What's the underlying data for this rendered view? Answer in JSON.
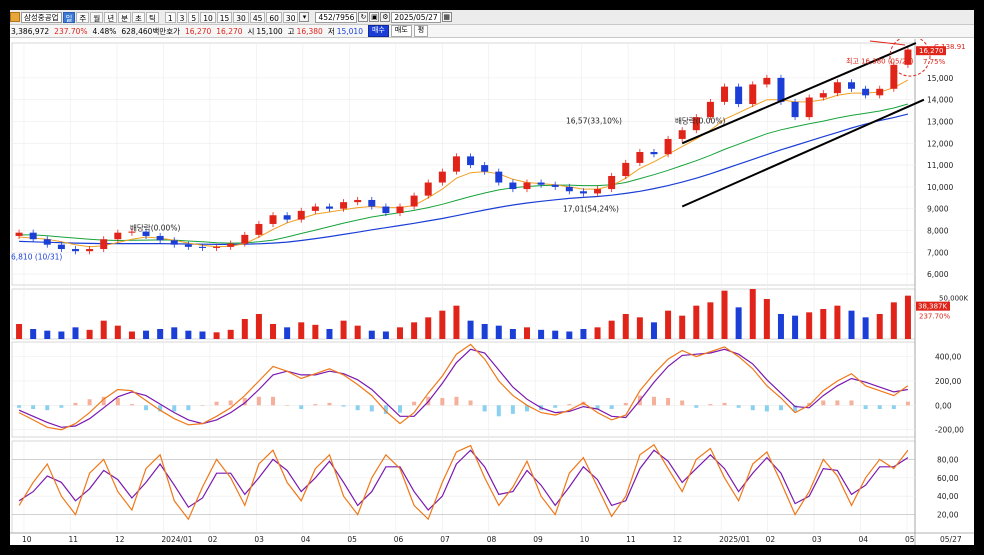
{
  "toolbar": {
    "stock_name": "삼성중공업",
    "type_button": "일",
    "periods": [
      "주",
      "월",
      "년",
      "분",
      "초",
      "틱"
    ],
    "intervals": [
      "1",
      "3",
      "5",
      "10",
      "15",
      "30",
      "45",
      "60"
    ],
    "interval_selected": "30",
    "count": "452",
    "total": "7956",
    "date": "2025/05/27"
  },
  "quote": {
    "volume": "3,386,972",
    "vol_ratio": "237.70%",
    "change_rate": "4.48%",
    "amount": "628,460백만",
    "quote_label": "호가",
    "ask": "16,270",
    "bid": "16,270",
    "open_label": "시",
    "open": "15,100",
    "high_label": "고",
    "high": "16,380",
    "low_label": "저",
    "low": "15,010",
    "buy": "매수",
    "sell": "매도",
    "eval": "평"
  },
  "colors": {
    "up": "#e0241a",
    "down": "#1b3fd6",
    "ma5": "#c0169a",
    "ma20": "#f0a020",
    "ma60": "#16a33a",
    "ma120": "#1b3fd6",
    "macd": "#f07818",
    "signal": "#7a18b0",
    "osc_pos": "#f4b09a",
    "osc_neg": "#8ad0f0"
  },
  "chart_data": [
    {
      "type": "line",
      "name": "price",
      "x_labels": [
        "10",
        "11",
        "12",
        "2024/01",
        "02",
        "03",
        "04",
        "05",
        "06",
        "07",
        "08",
        "09",
        "10",
        "11",
        "12",
        "2025/01",
        "02",
        "03",
        "04",
        "05"
      ],
      "right_axis_label": "05/27",
      "yticks": [
        6000,
        7000,
        8000,
        9000,
        10000,
        11000,
        12000,
        13000,
        14000,
        15000
      ],
      "ytick_labels": [
        "6,000",
        "7,000",
        "8,000",
        "9,000",
        "10,000",
        "11,000",
        "12,000",
        "13,000",
        "14,000",
        "15,000"
      ],
      "ylim": [
        5500,
        16600
      ],
      "close": [
        7900,
        7600,
        7350,
        7150,
        7050,
        7150,
        7600,
        7900,
        7950,
        7750,
        7550,
        7350,
        7250,
        7200,
        7250,
        7400,
        7800,
        8300,
        8700,
        8500,
        8900,
        9100,
        9000,
        9300,
        9400,
        9100,
        8800,
        9100,
        9600,
        10200,
        10700,
        11400,
        11000,
        10700,
        10200,
        9900,
        10200,
        10100,
        10000,
        9800,
        9700,
        9900,
        10500,
        11100,
        11600,
        11500,
        12200,
        12600,
        13200,
        13900,
        14600,
        13800,
        14700,
        15000,
        13900,
        13200,
        14100,
        14300,
        14800,
        14500,
        14200,
        14500,
        15600,
        16300
      ],
      "ma20": [
        7700,
        7650,
        7600,
        7480,
        7350,
        7250,
        7300,
        7450,
        7600,
        7700,
        7650,
        7550,
        7420,
        7320,
        7250,
        7280,
        7400,
        7700,
        8050,
        8350,
        8550,
        8750,
        8850,
        8950,
        9050,
        9100,
        9050,
        9050,
        9150,
        9500,
        9900,
        10400,
        10650,
        10700,
        10600,
        10350,
        10200,
        10150,
        10100,
        10000,
        9900,
        9900,
        10050,
        10400,
        10850,
        11150,
        11500,
        11850,
        12200,
        12600,
        13100,
        13400,
        13700,
        14000,
        14000,
        13900,
        13900,
        14000,
        14200,
        14300,
        14300,
        14350,
        14550,
        14900
      ],
      "ma60": [
        7800,
        7800,
        7760,
        7700,
        7650,
        7600,
        7560,
        7540,
        7550,
        7560,
        7570,
        7560,
        7520,
        7480,
        7440,
        7420,
        7430,
        7480,
        7560,
        7700,
        7860,
        8020,
        8180,
        8340,
        8480,
        8620,
        8720,
        8820,
        8920,
        9050,
        9200,
        9380,
        9560,
        9720,
        9860,
        9960,
        10020,
        10060,
        10080,
        10080,
        10060,
        10060,
        10100,
        10200,
        10380,
        10560,
        10760,
        10980,
        11200,
        11450,
        11720,
        11960,
        12200,
        12440,
        12620,
        12760,
        12900,
        13020,
        13160,
        13280,
        13380,
        13480,
        13620,
        13800
      ],
      "ma120": [
        7500,
        7480,
        7460,
        7440,
        7420,
        7410,
        7400,
        7400,
        7400,
        7400,
        7400,
        7390,
        7380,
        7370,
        7360,
        7360,
        7370,
        7390,
        7420,
        7470,
        7540,
        7630,
        7720,
        7820,
        7920,
        8030,
        8130,
        8230,
        8330,
        8440,
        8550,
        8680,
        8810,
        8940,
        9060,
        9170,
        9260,
        9340,
        9410,
        9470,
        9520,
        9560,
        9620,
        9700,
        9800,
        9920,
        10060,
        10220,
        10400,
        10600,
        10820,
        11040,
        11260,
        11480,
        11700,
        11900,
        12100,
        12300,
        12500,
        12700,
        12880,
        13040,
        13180,
        13340
      ],
      "channel_upper": [
        [
          47,
          12000
        ],
        [
          63,
          16600
        ]
      ],
      "channel_lower": [
        [
          47,
          9100
        ],
        [
          63,
          14000
        ]
      ],
      "annotations": {
        "ex_dividend_1": "배당락(0.00%)",
        "ex_dividend_2": "배당락(0.00%)",
        "low_marker": "6,810 (10/31)",
        "mark_a": "16,57(33,10%)",
        "mark_b": "17,01(54,24%)",
        "high_marker": "최고 16,380 (05/27)",
        "last_price": "16,270",
        "last_change": "7.75%",
        "corner_label": "C 138.91"
      }
    },
    {
      "type": "bar",
      "name": "volume",
      "ytick_labels": [
        "50,000K"
      ],
      "last_volume": "38,387K",
      "last_ratio": "237.70%",
      "values": [
        18,
        12,
        10,
        9,
        14,
        11,
        22,
        16,
        9,
        10,
        12,
        14,
        10,
        9,
        8,
        11,
        24,
        30,
        18,
        14,
        20,
        17,
        12,
        22,
        16,
        10,
        9,
        14,
        20,
        26,
        34,
        40,
        22,
        18,
        16,
        12,
        14,
        11,
        10,
        9,
        12,
        14,
        22,
        30,
        26,
        20,
        34,
        28,
        40,
        44,
        58,
        38,
        60,
        48,
        30,
        28,
        32,
        36,
        40,
        34,
        26,
        30,
        44,
        52
      ],
      "ylim": [
        0,
        60
      ]
    },
    {
      "type": "line",
      "name": "MACD",
      "ytick_labels": [
        "400,00",
        "200,00",
        "0,00",
        "-200,00"
      ],
      "ylim": [
        -260,
        520
      ],
      "macd": [
        -60,
        -120,
        -180,
        -200,
        -150,
        -60,
        50,
        130,
        120,
        40,
        -40,
        -110,
        -160,
        -150,
        -90,
        -20,
        80,
        200,
        320,
        280,
        220,
        260,
        300,
        250,
        170,
        80,
        -50,
        -150,
        -60,
        100,
        240,
        420,
        500,
        380,
        200,
        80,
        0,
        -60,
        -80,
        -40,
        20,
        -60,
        -120,
        -80,
        120,
        260,
        380,
        450,
        400,
        440,
        480,
        400,
        300,
        160,
        60,
        -60,
        0,
        120,
        200,
        260,
        160,
        120,
        80,
        160
      ],
      "signal": [
        -40,
        -90,
        -140,
        -180,
        -170,
        -110,
        -20,
        70,
        110,
        80,
        10,
        -60,
        -120,
        -150,
        -120,
        -60,
        20,
        130,
        250,
        280,
        250,
        250,
        280,
        260,
        210,
        130,
        20,
        -90,
        -90,
        30,
        180,
        350,
        460,
        430,
        290,
        150,
        50,
        -20,
        -60,
        -50,
        -10,
        -30,
        -90,
        -100,
        40,
        190,
        320,
        410,
        420,
        430,
        460,
        420,
        340,
        210,
        100,
        -10,
        -20,
        80,
        160,
        220,
        190,
        150,
        110,
        130
      ]
    },
    {
      "type": "line",
      "name": "Stochastic",
      "ytick_labels": [
        "80,00",
        "60,00",
        "40,00",
        "20,00"
      ],
      "ylim": [
        0,
        100
      ],
      "k": [
        30,
        55,
        75,
        40,
        20,
        65,
        80,
        45,
        25,
        70,
        85,
        35,
        15,
        50,
        80,
        60,
        30,
        75,
        90,
        55,
        35,
        70,
        85,
        40,
        20,
        60,
        85,
        70,
        30,
        15,
        55,
        88,
        95,
        60,
        30,
        50,
        78,
        40,
        20,
        65,
        82,
        50,
        18,
        40,
        85,
        96,
        70,
        45,
        80,
        92,
        60,
        35,
        75,
        88,
        55,
        20,
        45,
        80,
        62,
        30,
        60,
        80,
        70,
        90
      ],
      "d": [
        35,
        45,
        62,
        55,
        35,
        48,
        68,
        58,
        38,
        55,
        75,
        52,
        28,
        38,
        65,
        65,
        42,
        60,
        80,
        68,
        45,
        60,
        78,
        55,
        30,
        45,
        72,
        72,
        45,
        25,
        40,
        75,
        90,
        72,
        42,
        45,
        68,
        52,
        30,
        50,
        72,
        58,
        30,
        35,
        70,
        90,
        78,
        55,
        70,
        85,
        70,
        45,
        65,
        82,
        65,
        32,
        40,
        70,
        68,
        42,
        52,
        72,
        72,
        82
      ]
    }
  ]
}
